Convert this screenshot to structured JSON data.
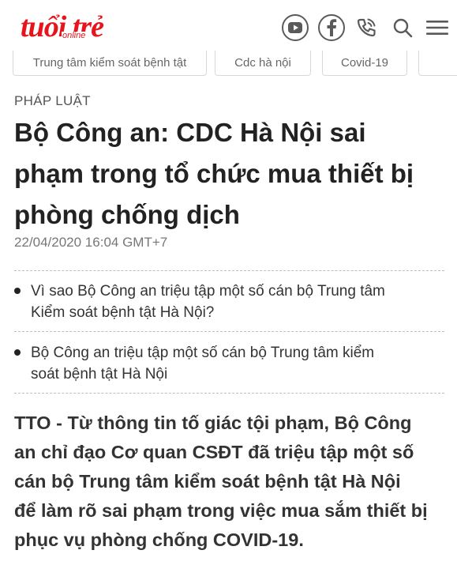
{
  "header": {
    "logo_text": "tuổi trẻ",
    "logo_sub": "online",
    "brand_color": "#e8141c",
    "icons": [
      "youtube-icon",
      "facebook-icon",
      "phone-icon",
      "search-icon",
      "menu-icon"
    ]
  },
  "tags": [
    "Trung tâm kiểm soát bệnh tật",
    "Cdc hà nội",
    "Covid-19"
  ],
  "article": {
    "category": "PHÁP LUẬT",
    "title_lines": [
      "Bộ Công an: CDC Hà Nội sai",
      "phạm trong tổ chức mua thiết bị",
      "phòng chống dịch"
    ],
    "date": "22/04/2020 16:04 GMT+7",
    "related": [
      {
        "lines": [
          "Vì sao Bộ Công an triệu tập một số cán bộ Trung tâm",
          "Kiểm soát bệnh tật Hà Nội?"
        ]
      },
      {
        "lines": [
          "Bộ Công an triệu tập một số cán bộ Trung tâm kiểm",
          "soát bệnh tật Hà Nội"
        ]
      }
    ],
    "lead_lines": [
      "TTO - Từ thông tin tố giác tội phạm, Bộ Công",
      "an chỉ đạo Cơ quan CSĐT đã triệu tập một số",
      "cán bộ Trung tâm kiểm soát bệnh tật Hà Nội",
      "để làm rõ sai phạm trong việc mua sắm thiết bị",
      "phục vụ phòng chống COVID-19."
    ]
  }
}
